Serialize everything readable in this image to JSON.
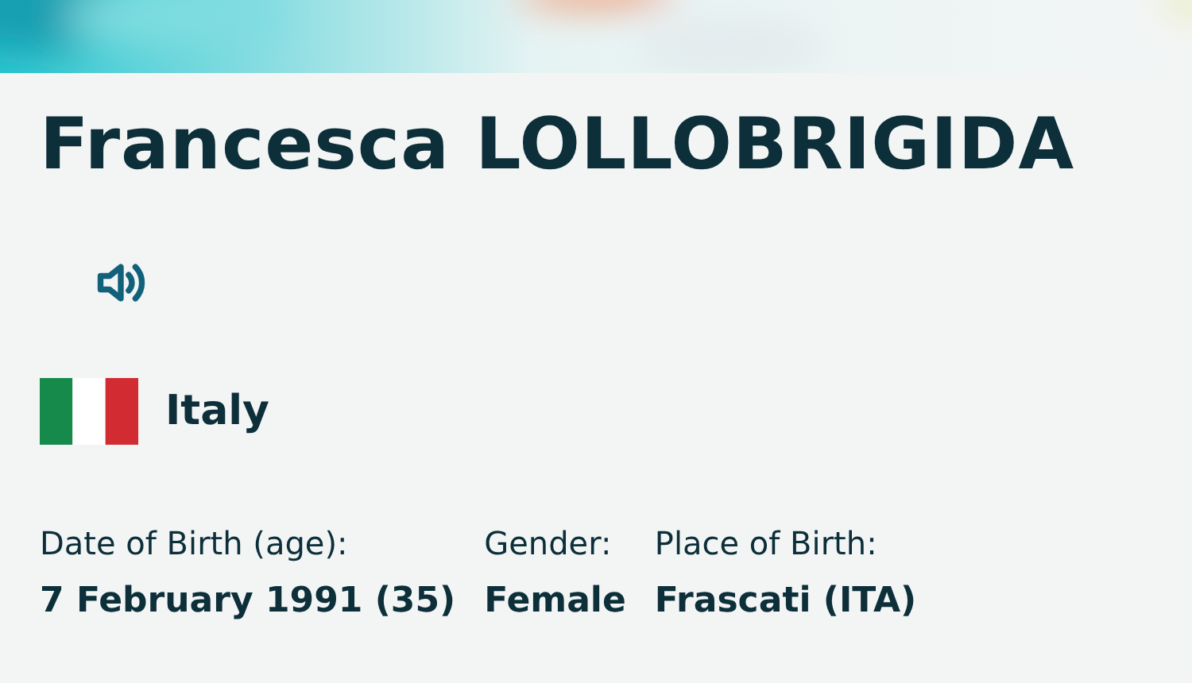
{
  "athlete": {
    "name": "Francesca LOLLOBRIGIDA",
    "country": "Italy"
  },
  "details": [
    {
      "label": "Date of Birth (age):",
      "value": "7 February 1991 (35)"
    },
    {
      "label": "Gender:",
      "value": "Female"
    },
    {
      "label": "Place of Birth:",
      "value": "Frascati (ITA)"
    }
  ]
}
